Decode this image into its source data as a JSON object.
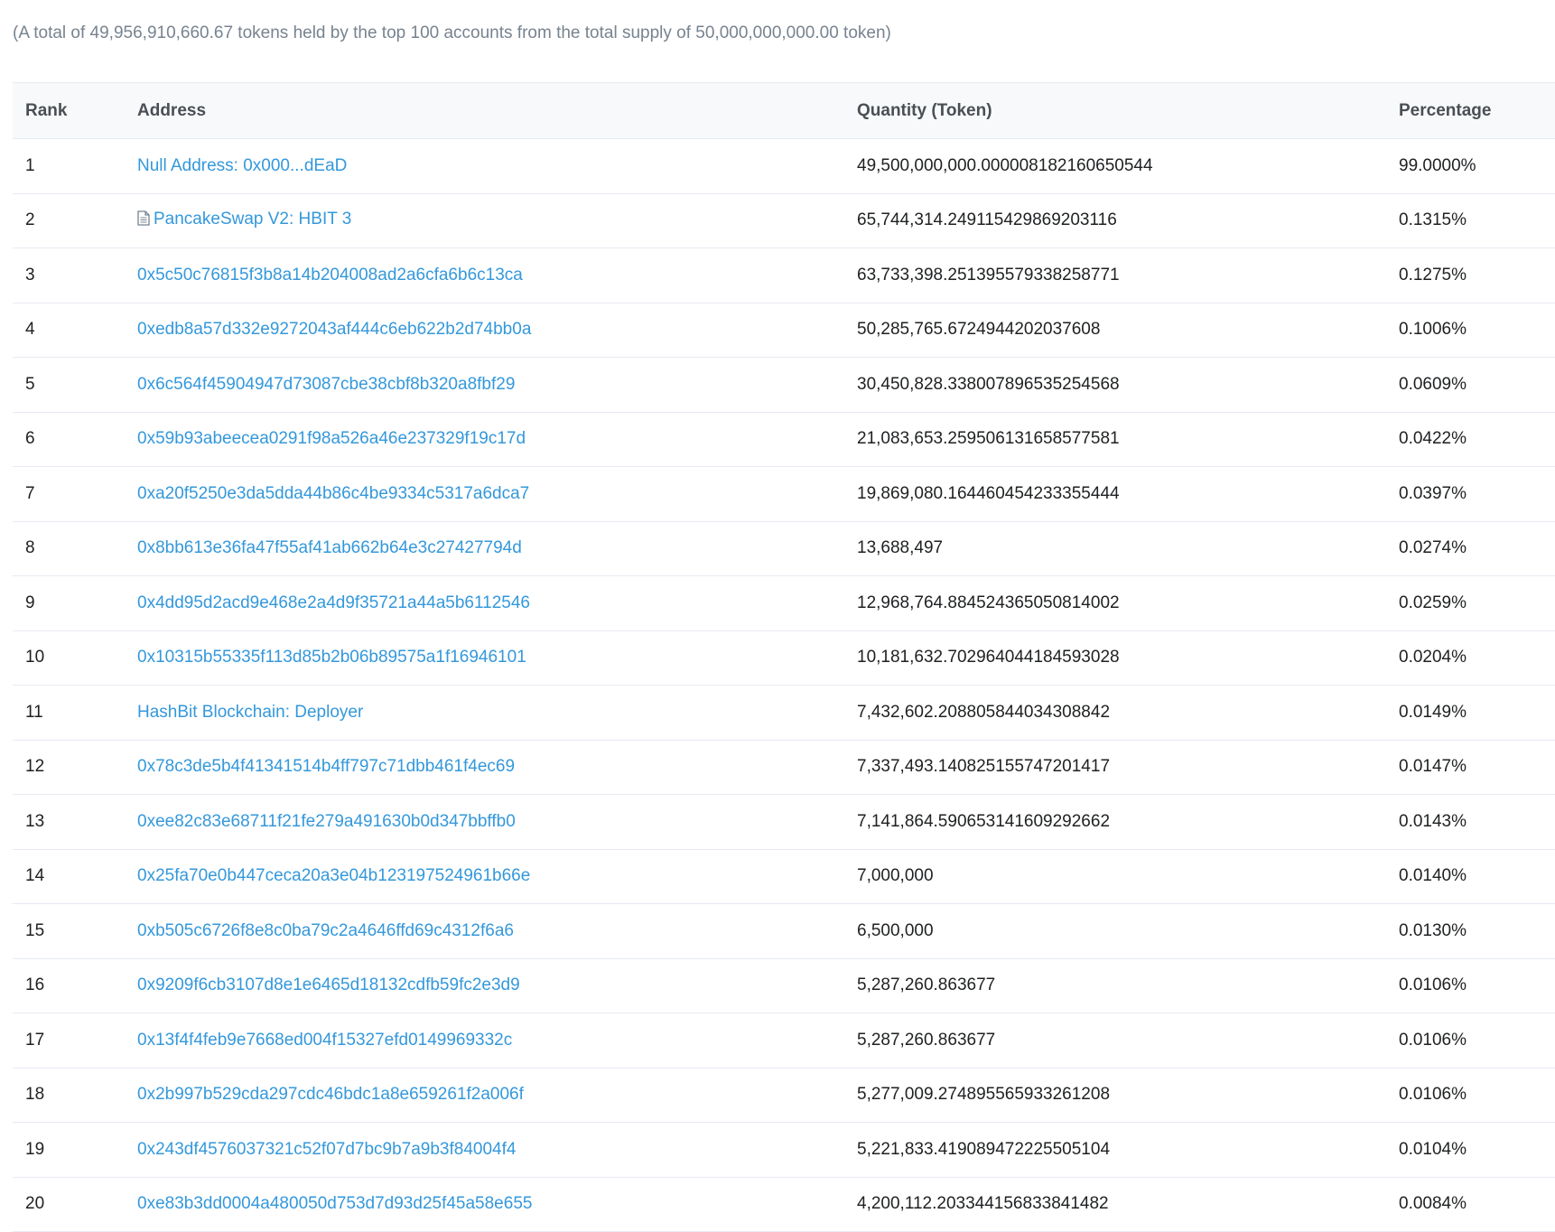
{
  "summary": "(A total of 49,956,910,660.67 tokens held by the top 100 accounts from the total supply of 50,000,000,000.00 token)",
  "columns": {
    "rank": "Rank",
    "address": "Address",
    "quantity": "Quantity (Token)",
    "percentage": "Percentage"
  },
  "link_color": "#3498db",
  "rows": [
    {
      "rank": "1",
      "address": "Null Address: 0x000...dEaD",
      "contract_icon": false,
      "quantity": "49,500,000,000.000008182160650544",
      "percentage": "99.0000%"
    },
    {
      "rank": "2",
      "address": "PancakeSwap V2: HBIT 3",
      "contract_icon": true,
      "quantity": "65,744,314.249115429869203116",
      "percentage": "0.1315%"
    },
    {
      "rank": "3",
      "address": "0x5c50c76815f3b8a14b204008ad2a6cfa6b6c13ca",
      "contract_icon": false,
      "quantity": "63,733,398.251395579338258771",
      "percentage": "0.1275%"
    },
    {
      "rank": "4",
      "address": "0xedb8a57d332e9272043af444c6eb622b2d74bb0a",
      "contract_icon": false,
      "quantity": "50,285,765.6724944202037608",
      "percentage": "0.1006%"
    },
    {
      "rank": "5",
      "address": "0x6c564f45904947d73087cbe38cbf8b320a8fbf29",
      "contract_icon": false,
      "quantity": "30,450,828.338007896535254568",
      "percentage": "0.0609%"
    },
    {
      "rank": "6",
      "address": "0x59b93abeecea0291f98a526a46e237329f19c17d",
      "contract_icon": false,
      "quantity": "21,083,653.259506131658577581",
      "percentage": "0.0422%"
    },
    {
      "rank": "7",
      "address": "0xa20f5250e3da5dda44b86c4be9334c5317a6dca7",
      "contract_icon": false,
      "quantity": "19,869,080.164460454233355444",
      "percentage": "0.0397%"
    },
    {
      "rank": "8",
      "address": "0x8bb613e36fa47f55af41ab662b64e3c27427794d",
      "contract_icon": false,
      "quantity": "13,688,497",
      "percentage": "0.0274%"
    },
    {
      "rank": "9",
      "address": "0x4dd95d2acd9e468e2a4d9f35721a44a5b6112546",
      "contract_icon": false,
      "quantity": "12,968,764.884524365050814002",
      "percentage": "0.0259%"
    },
    {
      "rank": "10",
      "address": "0x10315b55335f113d85b2b06b89575a1f16946101",
      "contract_icon": false,
      "quantity": "10,181,632.702964044184593028",
      "percentage": "0.0204%"
    },
    {
      "rank": "11",
      "address": "HashBit Blockchain: Deployer",
      "contract_icon": false,
      "quantity": "7,432,602.208805844034308842",
      "percentage": "0.0149%"
    },
    {
      "rank": "12",
      "address": "0x78c3de5b4f41341514b4ff797c71dbb461f4ec69",
      "contract_icon": false,
      "quantity": "7,337,493.140825155747201417",
      "percentage": "0.0147%"
    },
    {
      "rank": "13",
      "address": "0xee82c83e68711f21fe279a491630b0d347bbffb0",
      "contract_icon": false,
      "quantity": "7,141,864.590653141609292662",
      "percentage": "0.0143%"
    },
    {
      "rank": "14",
      "address": "0x25fa70e0b447ceca20a3e04b123197524961b66e",
      "contract_icon": false,
      "quantity": "7,000,000",
      "percentage": "0.0140%"
    },
    {
      "rank": "15",
      "address": "0xb505c6726f8e8c0ba79c2a4646ffd69c4312f6a6",
      "contract_icon": false,
      "quantity": "6,500,000",
      "percentage": "0.0130%"
    },
    {
      "rank": "16",
      "address": "0x9209f6cb3107d8e1e6465d18132cdfb59fc2e3d9",
      "contract_icon": false,
      "quantity": "5,287,260.863677",
      "percentage": "0.0106%"
    },
    {
      "rank": "17",
      "address": "0x13f4f4feb9e7668ed004f15327efd0149969332c",
      "contract_icon": false,
      "quantity": "5,287,260.863677",
      "percentage": "0.0106%"
    },
    {
      "rank": "18",
      "address": "0x2b997b529cda297cdc46bdc1a8e659261f2a006f",
      "contract_icon": false,
      "quantity": "5,277,009.274895565933261208",
      "percentage": "0.0106%"
    },
    {
      "rank": "19",
      "address": "0x243df4576037321c52f07d7bc9b7a9b3f84004f4",
      "contract_icon": false,
      "quantity": "5,221,833.419089472225505104",
      "percentage": "0.0104%"
    },
    {
      "rank": "20",
      "address": "0xe83b3dd0004a480050d753d7d93d25f45a58e655",
      "contract_icon": false,
      "quantity": "4,200,112.203344156833841482",
      "percentage": "0.0084%"
    }
  ]
}
